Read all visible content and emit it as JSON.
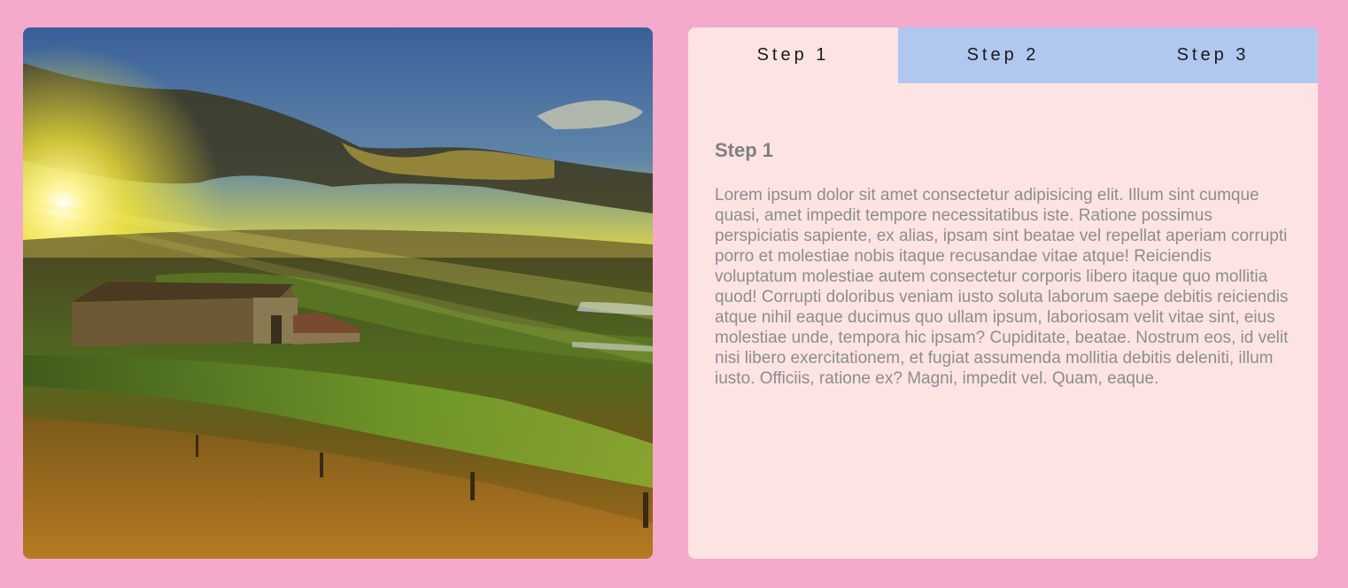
{
  "tabs": [
    {
      "label": "Step 1",
      "active": true
    },
    {
      "label": "Step 2",
      "active": false
    },
    {
      "label": "Step 3",
      "active": false
    }
  ],
  "content": {
    "heading": "Step 1",
    "body": "Lorem ipsum dolor sit amet consectetur adipisicing elit. Illum sint cumque quasi, amet impedit tempore necessitatibus iste. Ratione possimus perspiciatis sapiente, ex alias, ipsam sint beatae vel repellat aperiam corrupti porro et molestiae nobis itaque recusandae vitae atque! Reiciendis voluptatum molestiae autem consectetur corporis libero itaque quo mollitia quod! Corrupti doloribus veniam iusto soluta laborum saepe debitis reiciendis atque nihil eaque ducimus quo ullam ipsum, laboriosam velit vitae sint, eius molestiae unde, tempora hic ipsam? Cupiditate, beatae. Nostrum eos, id velit nisi libero exercitationem, et fugiat assumenda mollitia debitis deleniti, illum iusto. Officiis, ratione ex? Magni, impedit vel. Quam, eaque."
  },
  "colors": {
    "page_background": "#f5a9cb",
    "panel_background": "#fde4e2",
    "inactive_tab": "#b1c7ef"
  },
  "image": {
    "subject": "sunset-landscape-farmhouse"
  }
}
